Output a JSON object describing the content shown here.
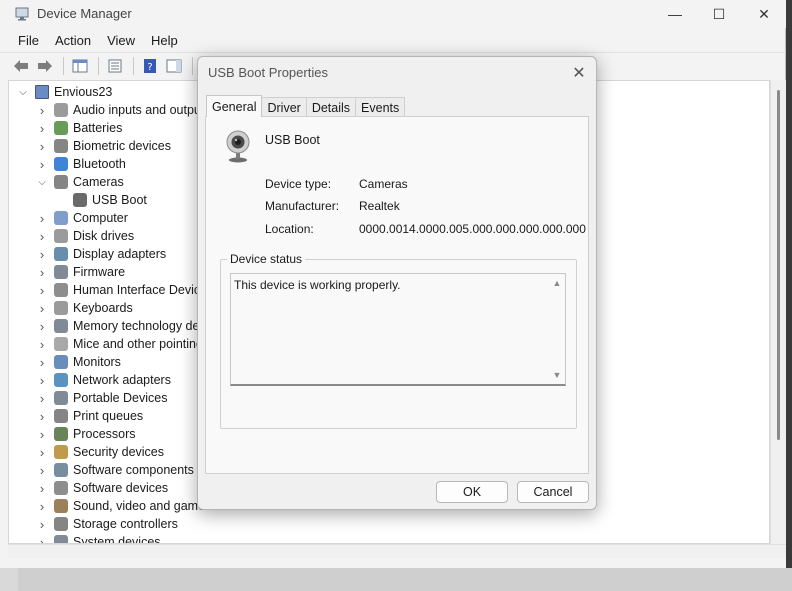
{
  "window": {
    "title": "Device Manager",
    "controls": {
      "minimize": "—",
      "maximize": "☐",
      "close": "✕"
    }
  },
  "menu": [
    "File",
    "Action",
    "View",
    "Help"
  ],
  "tree": {
    "root": "Envious23",
    "items": [
      {
        "label": "Audio inputs and outputs",
        "icon": "speaker-icon",
        "expanded": false
      },
      {
        "label": "Batteries",
        "icon": "battery-icon",
        "expanded": false
      },
      {
        "label": "Biometric devices",
        "icon": "fingerprint-icon",
        "expanded": false
      },
      {
        "label": "Bluetooth",
        "icon": "bluetooth-icon",
        "expanded": false
      },
      {
        "label": "Cameras",
        "icon": "camera-icon",
        "expanded": true
      },
      {
        "label": "USB Boot",
        "icon": "webcam-icon",
        "child": true
      },
      {
        "label": "Computer",
        "icon": "computer-icon",
        "expanded": false
      },
      {
        "label": "Disk drives",
        "icon": "disk-icon",
        "expanded": false
      },
      {
        "label": "Display adapters",
        "icon": "display-adapter-icon",
        "expanded": false
      },
      {
        "label": "Firmware",
        "icon": "firmware-icon",
        "expanded": false
      },
      {
        "label": "Human Interface Devices",
        "icon": "hid-icon",
        "expanded": false
      },
      {
        "label": "Keyboards",
        "icon": "keyboard-icon",
        "expanded": false
      },
      {
        "label": "Memory technology devices",
        "icon": "memory-icon",
        "expanded": false
      },
      {
        "label": "Mice and other pointing devices",
        "icon": "mouse-icon",
        "expanded": false
      },
      {
        "label": "Monitors",
        "icon": "monitor-icon",
        "expanded": false
      },
      {
        "label": "Network adapters",
        "icon": "network-icon",
        "expanded": false
      },
      {
        "label": "Portable Devices",
        "icon": "portable-device-icon",
        "expanded": false
      },
      {
        "label": "Print queues",
        "icon": "printer-icon",
        "expanded": false
      },
      {
        "label": "Processors",
        "icon": "processor-icon",
        "expanded": false
      },
      {
        "label": "Security devices",
        "icon": "security-icon",
        "expanded": false
      },
      {
        "label": "Software components",
        "icon": "software-component-icon",
        "expanded": false
      },
      {
        "label": "Software devices",
        "icon": "software-device-icon",
        "expanded": false
      },
      {
        "label": "Sound, video and game controllers",
        "icon": "sound-icon",
        "expanded": false
      },
      {
        "label": "Storage controllers",
        "icon": "storage-icon",
        "expanded": false
      },
      {
        "label": "System devices",
        "icon": "system-icon",
        "expanded": false
      }
    ]
  },
  "dialog": {
    "title": "USB Boot Properties",
    "close": "✕",
    "tabs": [
      "General",
      "Driver",
      "Details",
      "Events"
    ],
    "active_tab": "General",
    "device_name": "USB Boot",
    "properties": [
      {
        "label": "Device type:",
        "value": "Cameras"
      },
      {
        "label": "Manufacturer:",
        "value": "Realtek"
      },
      {
        "label": "Location:",
        "value": "0000.0014.0000.005.000.000.000.000.000"
      }
    ],
    "status_legend": "Device status",
    "status_text": "This device is working properly.",
    "ok_label": "OK",
    "cancel_label": "Cancel"
  }
}
